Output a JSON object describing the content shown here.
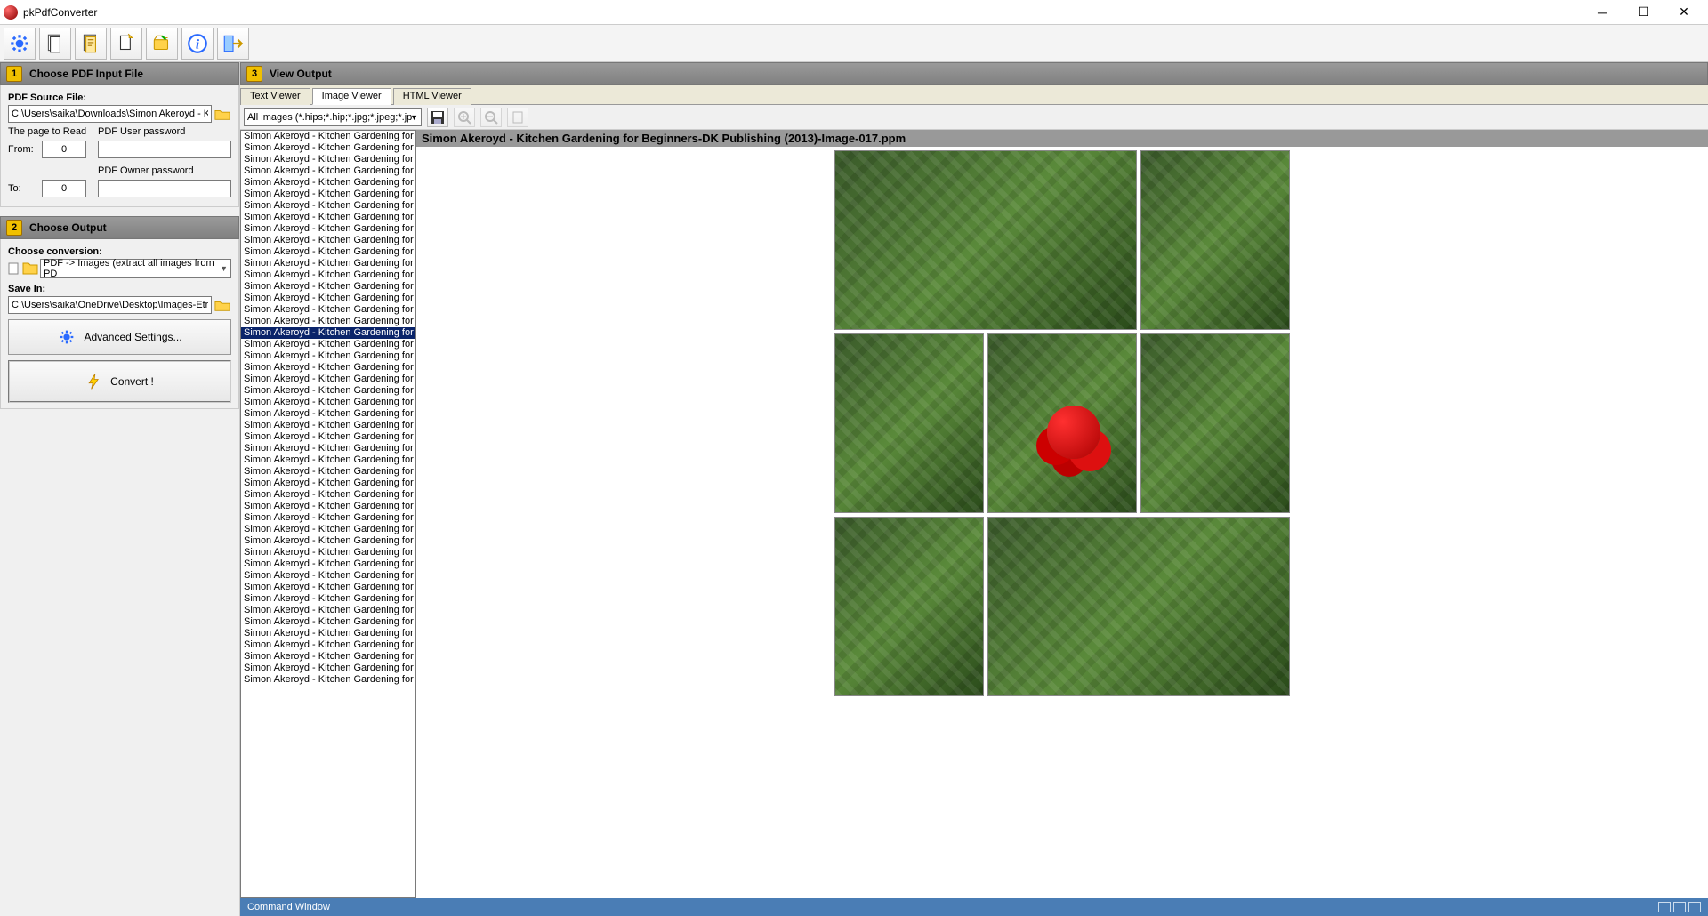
{
  "titlebar": {
    "title": "pkPdfConverter"
  },
  "panels": {
    "step1": {
      "num": "1",
      "title": "Choose PDF Input File",
      "source_label": "PDF Source File:",
      "source_value": "C:\\Users\\saika\\Downloads\\Simon Akeroyd - Kit",
      "page_label": "The page to Read",
      "userpw_label": "PDF User password",
      "from_label": "From:",
      "from_value": "0",
      "to_label": "To:",
      "to_value": "0",
      "ownerpw_label": "PDF Owner  password"
    },
    "step2": {
      "num": "2",
      "title": "Choose Output",
      "conv_label": "Choose conversion:",
      "conv_value": "PDF -> Images (extract all images from PD",
      "savein_label": "Save In:",
      "savein_value": "C:\\Users\\saika\\OneDrive\\Desktop\\Images-Etra",
      "advanced": "Advanced Settings...",
      "convert": "Convert !"
    },
    "step3": {
      "num": "3",
      "title": "View Output",
      "tabs": [
        "Text Viewer",
        "Image Viewer",
        "HTML Viewer"
      ],
      "active_tab": 1,
      "filetype_filter": "All images (*.hips;*.hip;*.jpg;*.jpeg;*.jp",
      "image_title": "Simon Akeroyd - Kitchen Gardening for Beginners-DK Publishing (2013)-Image-017.ppm",
      "list_item": "Simon Akeroyd - Kitchen Gardening for",
      "list_count": 48,
      "selected_index": 17
    }
  },
  "status": {
    "text": "Command Window"
  }
}
